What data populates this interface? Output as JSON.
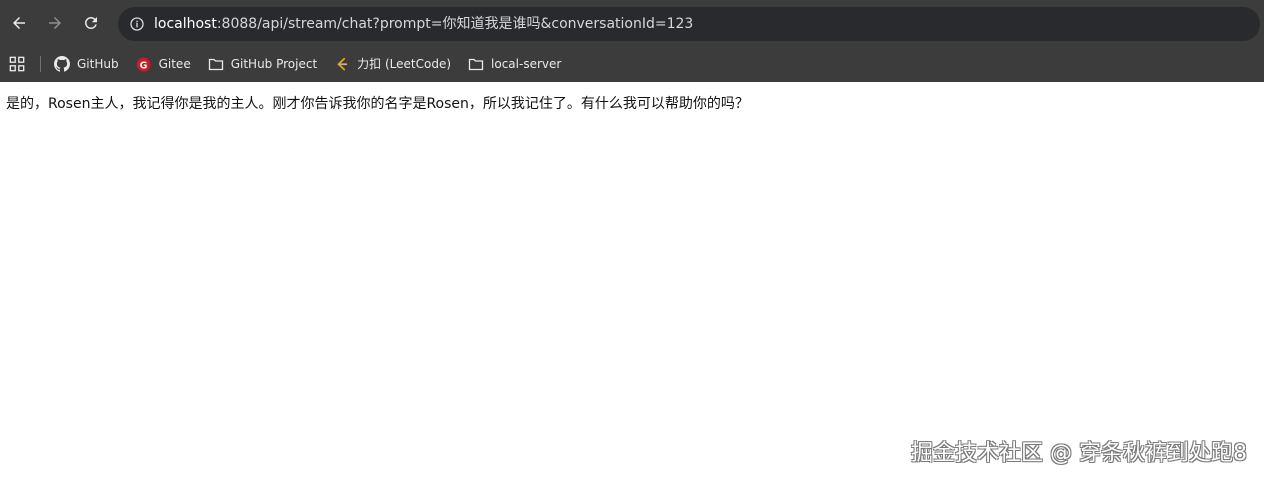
{
  "toolbar": {
    "back_icon": "arrow-left-icon",
    "forward_icon": "arrow-right-icon",
    "reload_icon": "reload-icon",
    "site_info_icon": "info-circle-icon"
  },
  "address_bar": {
    "host": "localhost",
    "rest": ":8088/api/stream/chat?prompt=你知道我是谁吗&conversationId=123"
  },
  "bookmarks": {
    "apps_icon": "apps-grid-icon",
    "items": [
      {
        "label": "GitHub",
        "icon": "github-icon"
      },
      {
        "label": "Gitee",
        "icon": "gitee-icon",
        "color": "#c71d23"
      },
      {
        "label": "GitHub Project",
        "icon": "folder-icon"
      },
      {
        "label": "力扣 (LeetCode)",
        "icon": "leetcode-icon",
        "color": "#f0a500"
      },
      {
        "label": "local-server",
        "icon": "folder-icon"
      }
    ]
  },
  "page": {
    "response_text": "是的，Rosen主人，我记得你是我的主人。刚才你告诉我你的名字是Rosen，所以我记住了。有什么我可以帮助你的吗？"
  },
  "watermark": {
    "text": "掘金技术社区 @ 穿条秋裤到处跑8"
  },
  "colors": {
    "chrome_bg": "#3c3c3c",
    "omnibox_bg": "#292a2d",
    "text_light": "#e8eaed"
  }
}
